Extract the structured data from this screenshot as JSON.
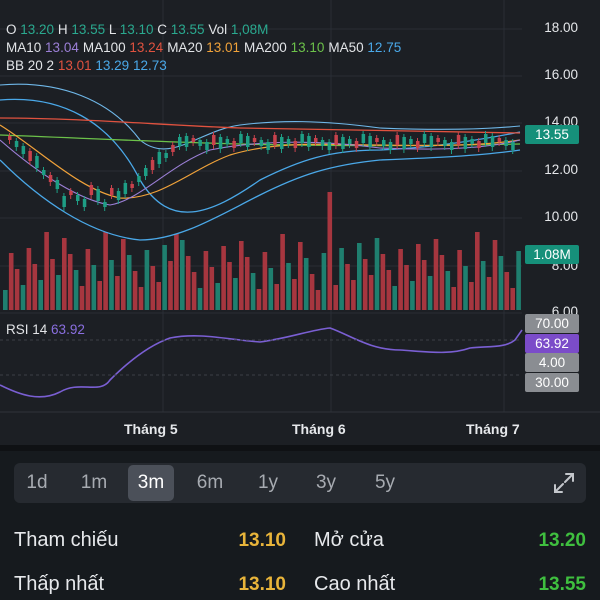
{
  "header": {
    "ohlc": {
      "o_label": "O",
      "o": "13.20",
      "h_label": "H",
      "h": "13.55",
      "l_label": "L",
      "l": "13.10",
      "c_label": "C",
      "c": "13.55",
      "vol_label": "Vol",
      "vol": "1,08M"
    },
    "ma": [
      {
        "label": "MA10",
        "value": "13.04",
        "color": "#9b7fd6"
      },
      {
        "label": "MA100",
        "value": "13.24",
        "color": "#e0523f"
      },
      {
        "label": "MA20",
        "value": "13.01",
        "color": "#f0a23a"
      },
      {
        "label": "MA200",
        "value": "13.10",
        "color": "#6cc24a"
      },
      {
        "label": "MA50",
        "value": "12.75",
        "color": "#4aa8e8"
      }
    ],
    "bb": {
      "label": "BB 20 2",
      "v1": "13.01",
      "v2": "13.29",
      "v3": "12.73"
    }
  },
  "price_axis": [
    "18.00",
    "16.00",
    "14.00",
    "12.00",
    "10.00",
    "8.00",
    "6.00"
  ],
  "price_tag": {
    "text": "13.55",
    "color": "#16907a"
  },
  "volume_tag": {
    "text": "1.08M",
    "color": "#16907a"
  },
  "rsi": {
    "label": "RSI 14",
    "value": "63.92",
    "levels": {
      "upper": "70.00",
      "middle": "4.00",
      "lower": "30.00"
    },
    "value_color": "#7b4cc9"
  },
  "months": [
    "Tháng 5",
    "Tháng 6",
    "Tháng 7"
  ],
  "tabs": [
    {
      "label": "1d",
      "active": false
    },
    {
      "label": "1m",
      "active": false
    },
    {
      "label": "3m",
      "active": true
    },
    {
      "label": "6m",
      "active": false
    },
    {
      "label": "1y",
      "active": false
    },
    {
      "label": "3y",
      "active": false
    },
    {
      "label": "5y",
      "active": false
    }
  ],
  "stats": {
    "ref_label": "Tham chiếu",
    "ref_value": "13.10",
    "open_label": "Mở cửa",
    "open_value": "13.20",
    "low_label": "Thấp nhất",
    "low_value": "13.10",
    "high_label": "Cao nhất",
    "high_value": "13.55"
  },
  "colors": {
    "up": "#1e9e85",
    "down": "#c8424c",
    "up_vol": "#1f7f6f",
    "down_vol": "#a6363f",
    "yellow": "#e8b43a",
    "green": "#3fbf3f",
    "rsi_line": "#7a5fd3"
  }
}
